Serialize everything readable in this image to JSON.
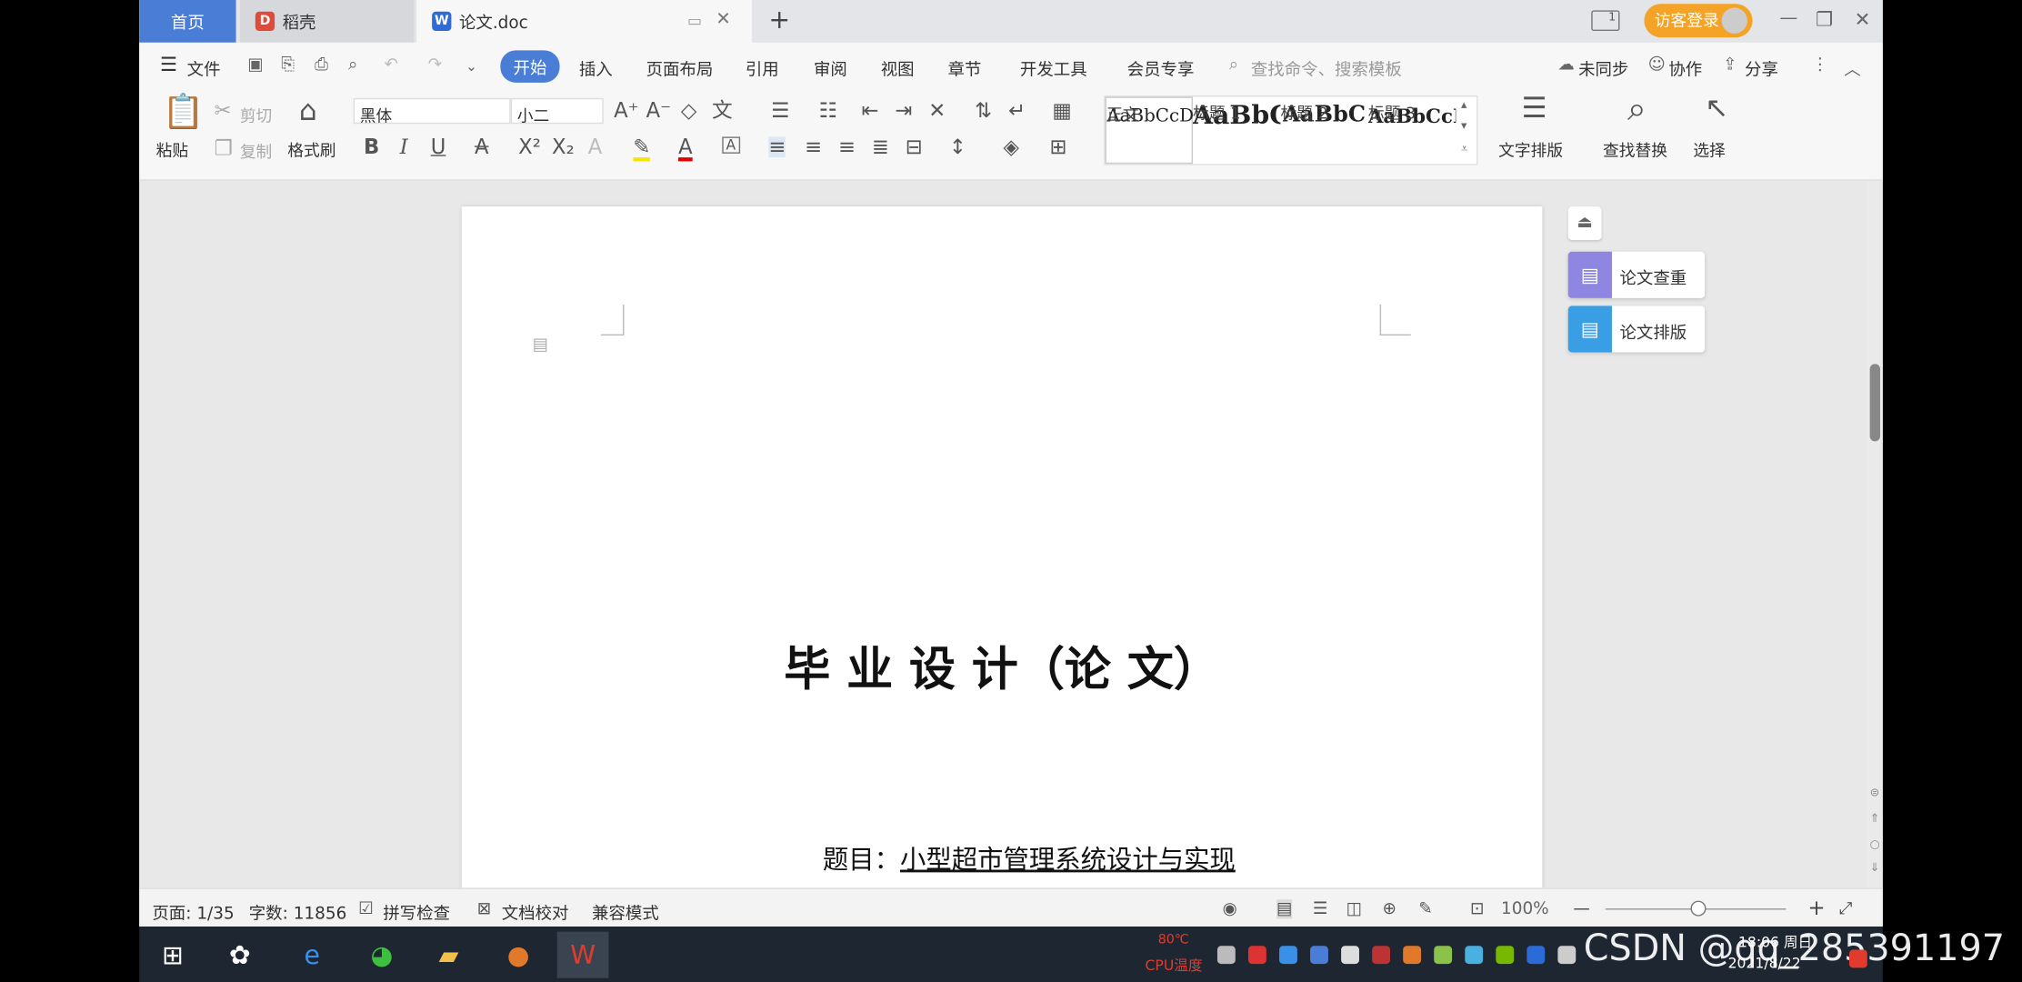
{
  "tabs": {
    "home": "首页",
    "daoke": "稻壳",
    "doc": "论文.doc",
    "new_tab": "+"
  },
  "window": {
    "login": "访客登录",
    "minimize": "—",
    "restore": "❐",
    "close": "✕"
  },
  "menu": {
    "file": "文件",
    "items": [
      "开始",
      "插入",
      "页面布局",
      "引用",
      "审阅",
      "视图",
      "章节",
      "开发工具",
      "会员专享"
    ],
    "search_placeholder": "查找命令、搜索模板",
    "unsynced": "未同步",
    "collaborate": "协作",
    "share": "分享"
  },
  "ribbon": {
    "paste": "粘贴",
    "cut": "剪切",
    "copy": "复制",
    "format_painter": "格式刷",
    "font_name": "黑体",
    "font_size": "小二",
    "styles": [
      {
        "preview": "AaBbCcD",
        "name": "正文"
      },
      {
        "preview": "AaBbC",
        "name": "标题 1"
      },
      {
        "preview": "AaBbC",
        "name": "标题 2"
      },
      {
        "preview": "AaBbCcI",
        "name": "标题 3"
      }
    ],
    "text_layout": "文字排版",
    "find_replace": "查找替换",
    "select": "选择"
  },
  "side_panel": {
    "check": "论文查重",
    "layout": "论文排版"
  },
  "document": {
    "title": "毕 业 设 计（论 文）",
    "subject_label": "题目：",
    "subject_value": "小型超市管理系统设计与实现"
  },
  "status": {
    "page": "页面: 1/35",
    "words": "字数: 11856",
    "spell": "拼写检查",
    "proof": "文档校对",
    "compat": "兼容模式",
    "zoom": "100%"
  },
  "taskbar": {
    "temp": "80℃",
    "cpu": "CPU温度",
    "time": "18:06 周日",
    "date": "2021/8/22",
    "watermark": "CSDN @qq_285391197"
  }
}
